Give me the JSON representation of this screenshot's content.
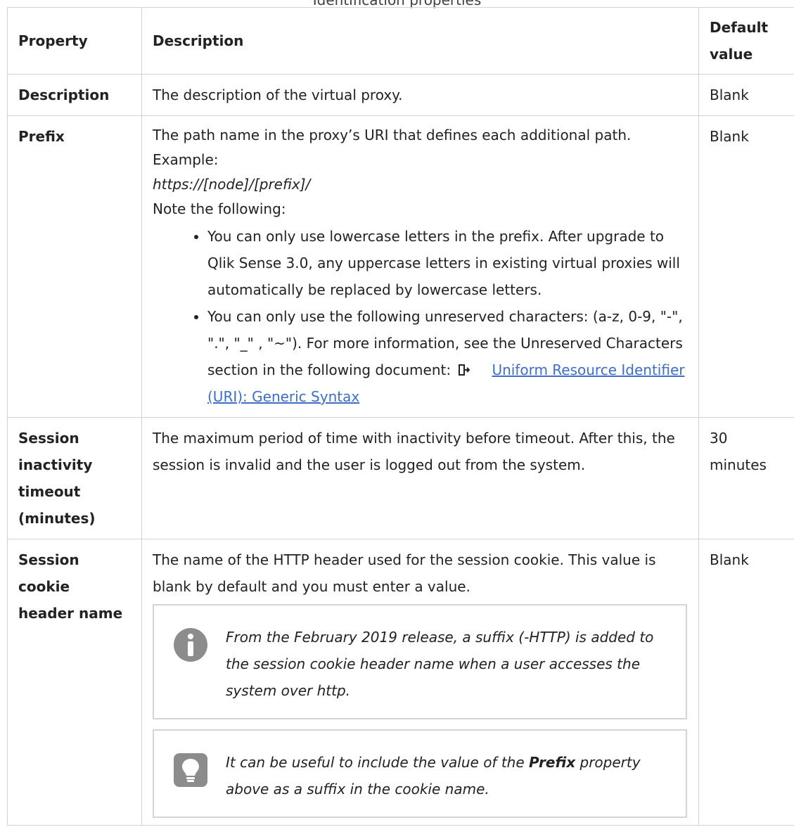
{
  "caption": "Identification properties",
  "headers": {
    "property": "Property",
    "description": "Description",
    "default_line1": "Default",
    "default_line2": "value"
  },
  "rows": {
    "description": {
      "property": "Description",
      "text": "The description of the virtual proxy.",
      "default": "Blank"
    },
    "prefix": {
      "property": "Prefix",
      "line1": "The path name in the proxy’s URI that defines each additional path.",
      "line2": "Example:",
      "example": "https://[node]/[prefix]/",
      "line3": "Note the following:",
      "bullet1": "You can only use lowercase letters in the prefix. After upgrade to Qlik Sense 3.0, any uppercase letters in existing virtual proxies will automatically be replaced by lowercase letters.",
      "bullet2_text": "You can only use the following unreserved characters: (a-z, 0-9, \"-\", \".\", \"_\" , \"~\"). For more information, see the Unreserved Characters section in the following document: ",
      "bullet2_link": "Uniform Resource Identifier (URI): Generic Syntax",
      "default": "Blank"
    },
    "timeout": {
      "property_line1": "Session",
      "property_line2": "inactivity",
      "property_line3": "timeout",
      "property_line4": "(minutes)",
      "text": "The maximum period of time with inactivity before timeout. After this, the session is invalid and the user is logged out from the system.",
      "default_line1": "30",
      "default_line2": "minutes"
    },
    "cookie": {
      "property_line1": "Session",
      "property_line2": "cookie",
      "property_line3": "header name",
      "text": "The name of the HTTP header used for the session cookie. This value is blank by default and you must enter a value.",
      "note_info": "From the February 2019 release, a suffix (-HTTP) is added to the session cookie header name when a user accesses the system over http.",
      "note_tip_before": "It can be useful to include the value of the ",
      "note_tip_bold": "Prefix",
      "note_tip_after": " property above as a suffix in the cookie name.",
      "default": "Blank"
    }
  },
  "icons": {
    "external_link": "external-link-icon",
    "info": "info-icon",
    "tip": "lightbulb-icon"
  },
  "colors": {
    "link": "#3f6ec8",
    "border": "#d2d2d2",
    "icon_gray": "#8c8c8c"
  }
}
